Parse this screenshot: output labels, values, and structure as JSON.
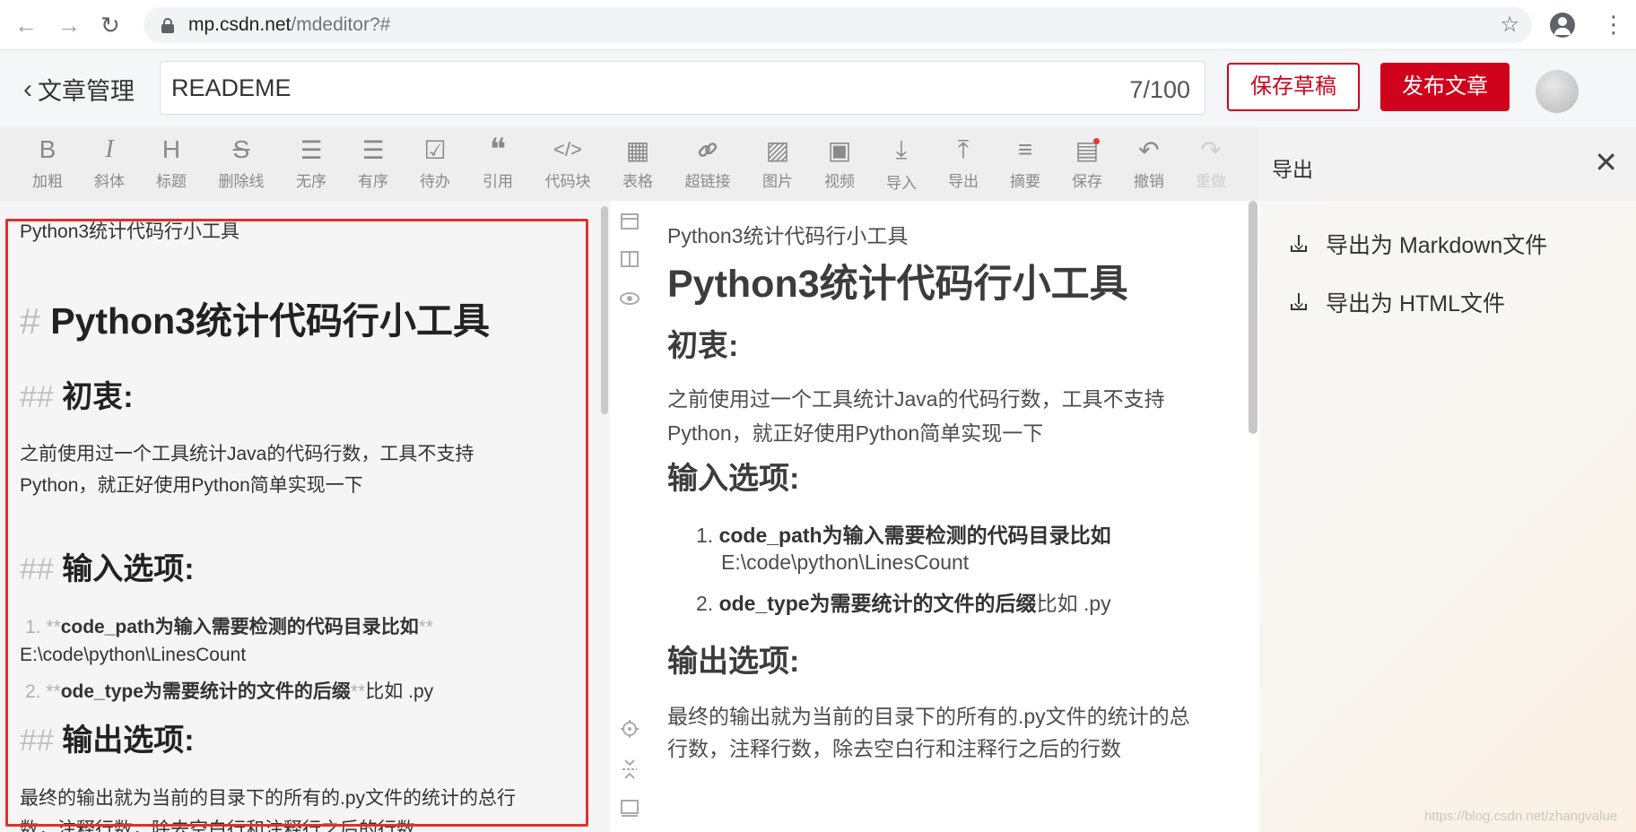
{
  "browser": {
    "back": "←",
    "forward": "→",
    "reload": "↻",
    "url_host": "mp.csdn.net",
    "url_path": "/mdeditor?#",
    "star": "☆",
    "menu": "⋮"
  },
  "header": {
    "back_label": "文章管理",
    "title_value": "READEME",
    "title_count": "7/100",
    "save_draft": "保存草稿",
    "publish": "发布文章"
  },
  "toolbar": [
    {
      "label": "加粗",
      "icon": "B"
    },
    {
      "label": "斜体",
      "icon": "I"
    },
    {
      "label": "标题",
      "icon": "H"
    },
    {
      "label": "删除线",
      "icon": "S"
    },
    {
      "label": "无序",
      "icon": "☰"
    },
    {
      "label": "有序",
      "icon": "☰"
    },
    {
      "label": "待办",
      "icon": "☑"
    },
    {
      "label": "引用",
      "icon": "❝"
    },
    {
      "label": "代码块",
      "icon": "</>"
    },
    {
      "label": "表格",
      "icon": "▦"
    },
    {
      "label": "超链接",
      "icon": "🔗"
    },
    {
      "label": "图片",
      "icon": "▨"
    },
    {
      "label": "视频",
      "icon": "▣"
    },
    {
      "label": "导入",
      "icon": "⤓"
    },
    {
      "label": "导出",
      "icon": "⤒"
    },
    {
      "label": "摘要",
      "icon": "≡"
    },
    {
      "label": "保存",
      "icon": "▤"
    },
    {
      "label": "撤销",
      "icon": "↶"
    },
    {
      "label": "重做",
      "icon": "↷"
    }
  ],
  "export": {
    "title": "导出",
    "close": "✕",
    "items": [
      "导出为 Markdown文件",
      "导出为 HTML文件"
    ]
  },
  "source": {
    "line1": "Python3统计代码行小工具",
    "h1_mark": "#",
    "h1": "Python3统计代码行小工具",
    "h2_mark": "##",
    "h2a": "初衷:",
    "para1a": "之前使用过一个工具统计Java的代码行数，工具不支持",
    "para1b": "Python，就正好使用Python简单实现一下",
    "h2b": "输入选项:",
    "li1_num": "1.",
    "li_mark": "**",
    "li1_bold": "code_path为输入需要检测的代码目录比如",
    "li1_cont": "E:\\code\\python\\LinesCount",
    "li2_num": "2.",
    "li2_bold": "ode_type为需要统计的文件的后缀",
    "li2_tail": "比如 .py",
    "h2c": "输出选项:",
    "para2a": "最终的输出就为当前的目录下的所有的.py文件的统计的总行",
    "para2b": "数，注释行数，除去空白行和注释行之后的行数"
  },
  "preview": {
    "line1": "Python3统计代码行小工具",
    "h1": "Python3统计代码行小工具",
    "h2a": "初衷:",
    "para1a": "之前使用过一个工具统计Java的代码行数，工具不支持",
    "para1b": "Python，就正好使用Python简单实现一下",
    "h2b": "输入选项:",
    "li1_num": "1.",
    "li1_bold": "code_path为输入需要检测的代码目录比如",
    "li1_cont": "E:\\code\\python\\LinesCount",
    "li2_num": "2.",
    "li2_bold": "ode_type为需要统计的文件的后缀",
    "li2_tail": "比如 .py",
    "h2c": "输出选项:",
    "para2a": "最终的输出就为当前的目录下的所有的.py文件的统计的总",
    "para2b": "行数，注释行数，除去空白行和注释行之后的行数"
  },
  "watermark": "https://blog.csdn.net/zhangvalue"
}
